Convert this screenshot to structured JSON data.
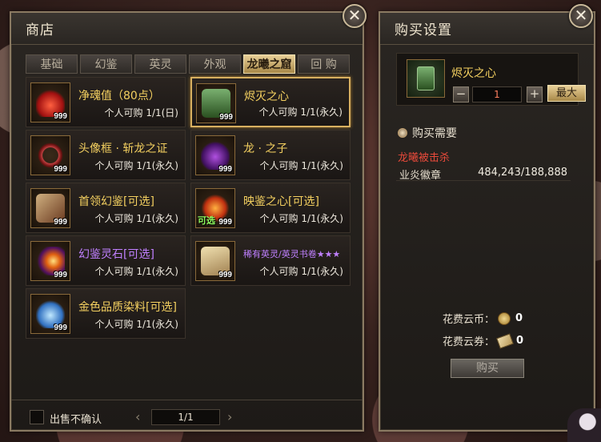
{
  "shop": {
    "title": "商店",
    "tabs": [
      {
        "label": "基础",
        "active": false
      },
      {
        "label": "幻鉴",
        "active": false
      },
      {
        "label": "英灵",
        "active": false
      },
      {
        "label": "外观",
        "active": false
      },
      {
        "label": "龙曦之窟",
        "active": true
      },
      {
        "label": "回 购",
        "active": false
      }
    ],
    "items": [
      {
        "name": "净魂值（80点）",
        "limit": "个人可购 1/1(日)",
        "qty": "999",
        "name_color": "gold",
        "optional_tag": "",
        "icon": "red-flame-icon"
      },
      {
        "name": "烬灭之心",
        "limit": "个人可购 1/1(永久)",
        "qty": "999",
        "name_color": "gold",
        "optional_tag": "",
        "icon": "green-jade-tablet-icon",
        "selected": true
      },
      {
        "name": "头像框 · 斩龙之证",
        "limit": "个人可购 1/1(永久)",
        "qty": "999",
        "name_color": "gold",
        "optional_tag": "",
        "icon": "red-ring-frame-icon"
      },
      {
        "name": "龙 · 之子",
        "limit": "个人可购 1/1(永久)",
        "qty": "999",
        "name_color": "gold",
        "optional_tag": "",
        "icon": "purple-dragon-icon"
      },
      {
        "name": "首领幻鉴[可选]",
        "limit": "个人可购 1/1(永久)",
        "qty": "999",
        "name_color": "gold",
        "optional_tag": "",
        "icon": "boss-card-icon"
      },
      {
        "name": "映鉴之心[可选]",
        "limit": "个人可购 1/1(永久)",
        "qty": "999",
        "name_color": "gold",
        "optional_tag": "可选",
        "icon": "flower-heart-icon"
      },
      {
        "name": "幻鉴灵石[可选]",
        "limit": "个人可购 1/1(永久)",
        "qty": "999",
        "name_color": "purple",
        "optional_tag": "",
        "icon": "glowing-orb-icon"
      },
      {
        "name": "稀有英灵/英灵书卷★★★",
        "limit": "个人可购 1/1(永久)",
        "qty": "999",
        "name_color": "purple",
        "optional_tag": "",
        "icon": "scroll-icon"
      },
      {
        "name": "金色品质染料[可选]",
        "limit": "个人可购 1/1(永久)",
        "qty": "999",
        "name_color": "gold",
        "optional_tag": "",
        "icon": "dye-potion-icon"
      }
    ],
    "footer": {
      "no_confirm_label": "出售不确认",
      "page": "1/1"
    }
  },
  "buy": {
    "title": "购买设置",
    "selected_name": "烬灭之心",
    "quantity": "1",
    "minus_label": "−",
    "plus_label": "+",
    "max_label": "最大",
    "requirements_title": "购买需要",
    "requirement_red": "龙曦被击杀",
    "currency_name": "业炎徽章",
    "currency_value": "484,243/188,888",
    "cost_coin_label": "花费云币：",
    "cost_coin_value": "0",
    "cost_ticket_label": "花费云券：",
    "cost_ticket_value": "0",
    "buy_label": "购买"
  },
  "close_label": "✕",
  "colors": {
    "gold_text": "#f4d060",
    "purple_text": "#c080ff",
    "red_text": "#e84a3a",
    "active_tab": "#e8d098"
  }
}
